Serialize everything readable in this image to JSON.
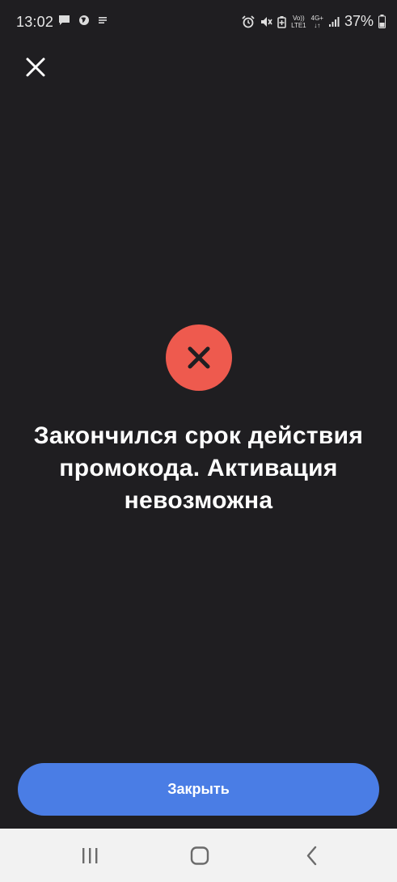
{
  "status_bar": {
    "time": "13:02",
    "network_top": "Vo))",
    "network_bottom": "LTE1",
    "network_type": "4G+",
    "battery": "37%"
  },
  "dialog": {
    "close_icon": "close-icon",
    "status_icon": "error-x-icon",
    "status_color": "#ee5a4e",
    "message": "Закончился срок действия промокода. Активация невозможна",
    "close_button_label": "Закрыть",
    "accent_color": "#4a7de5"
  },
  "nav_bar": {
    "recents": "recents-icon",
    "home": "home-icon",
    "back": "back-icon"
  }
}
